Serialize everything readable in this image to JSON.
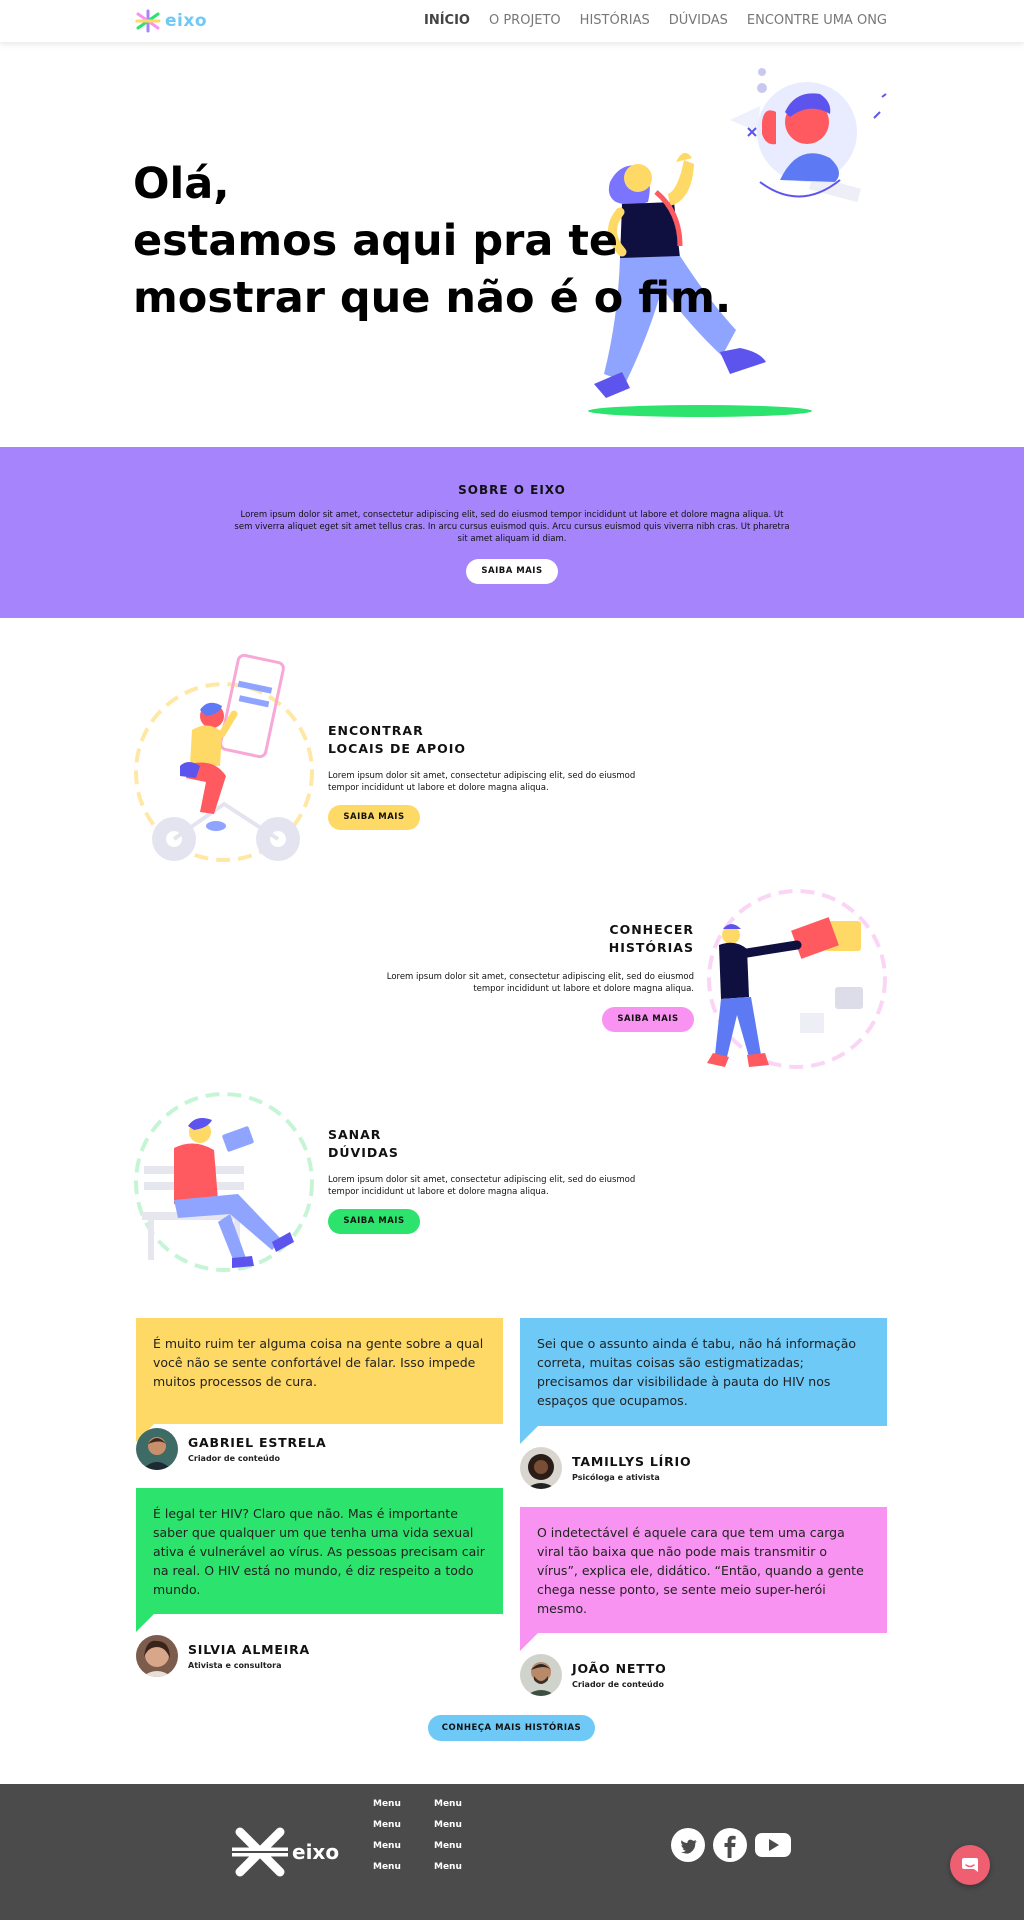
{
  "brand": {
    "name": "eixo"
  },
  "nav": {
    "items": [
      {
        "label": "INÍCIO",
        "active": true
      },
      {
        "label": "O PROJETO"
      },
      {
        "label": "HISTÓRIAS"
      },
      {
        "label": "DÚVIDAS"
      },
      {
        "label": "ENCONTRE UMA ONG"
      }
    ]
  },
  "hero": {
    "lines": [
      "Olá,",
      "estamos aqui pra te",
      "mostrar que não é o fim."
    ]
  },
  "about": {
    "title": "SOBRE O EIXO",
    "text": "Lorem ipsum dolor sit amet, consectetur adipiscing elit, sed do eiusmod tempor incididunt ut labore et dolore magna aliqua. Ut sem viverra aliquet eget sit amet tellus cras. In arcu cursus euismod quis. Arcu cursus euismod quis viverra nibh cras. Ut pharetra sit amet aliquam id diam.",
    "button": "SAIBA MAIS",
    "color": "#a684fb"
  },
  "features": [
    {
      "title1": "ENCONTRAR",
      "title2": "LOCAIS DE APOIO",
      "text": "Lorem ipsum dolor sit amet, consectetur adipiscing elit, sed do eiusmod tempor incididunt ut labore et dolore magna aliqua.",
      "button": "SAIBA MAIS",
      "color": "#ffd966"
    },
    {
      "title1": "CONHECER",
      "title2": "HISTÓRIAS",
      "text": "Lorem ipsum dolor sit amet, consectetur adipiscing elit, sed do eiusmod tempor incididunt ut labore et dolore magna aliqua.",
      "button": "SAIBA MAIS",
      "color": "#f993f2"
    },
    {
      "title1": "SANAR",
      "title2": "DÚVIDAS",
      "text": "Lorem ipsum dolor sit amet, consectetur adipiscing elit, sed do eiusmod tempor incididunt ut labore et dolore magna aliqua.",
      "button": "SAIBA MAIS",
      "color": "#2be36d"
    }
  ],
  "testimonials": [
    {
      "quote": "É muito ruim ter alguma coisa na gente sobre a qual você não se sente confortável de falar. Isso impede muitos processos de cura.",
      "name": "GABRIEL ESTRELA",
      "role": "Criador de conteúdo",
      "color": "#ffd966"
    },
    {
      "quote": "Sei que o assunto ainda é tabu, não há informação correta, muitas coisas são estigmatizadas; precisamos dar visibilidade à pauta do HIV nos espaços que ocupamos.",
      "name": "TAMILLYS LÍRIO",
      "role": "Psicóloga e ativista",
      "color": "#6ec9f7"
    },
    {
      "quote": "É legal ter HIV? Claro que não. Mas é importante saber que qualquer um que tenha uma vida sexual ativa é vulnerável ao vírus. As pessoas precisam cair na real. O HIV está no mundo, é diz respeito a todo mundo.",
      "name": "SILVIA ALMEIRA",
      "role": "Ativista e consultora",
      "color": "#2be36d"
    },
    {
      "quote": "O indetectável é aquele cara que tem uma carga viral tão baixa que não pode mais transmitir o vírus”, explica ele, didático. “Então, quando a gente chega nesse ponto, se sente meio super-herói mesmo.",
      "name": "JOÃO NETTO",
      "role": "Criador de conteúdo",
      "color": "#f993f2"
    }
  ],
  "more_button": "CONHEÇA MAIS HISTÓRIAS",
  "footer": {
    "brand": "eixo",
    "menu_col1": [
      "Menu",
      "Menu",
      "Menu",
      "Menu"
    ],
    "menu_col2": [
      "Menu",
      "Menu",
      "Menu",
      "Menu"
    ],
    "social": [
      "twitter-icon",
      "facebook-icon",
      "youtube-icon"
    ],
    "bg": "#4b4b4b"
  },
  "chat": {
    "icon": "chat-icon",
    "color": "#ef5f72"
  }
}
